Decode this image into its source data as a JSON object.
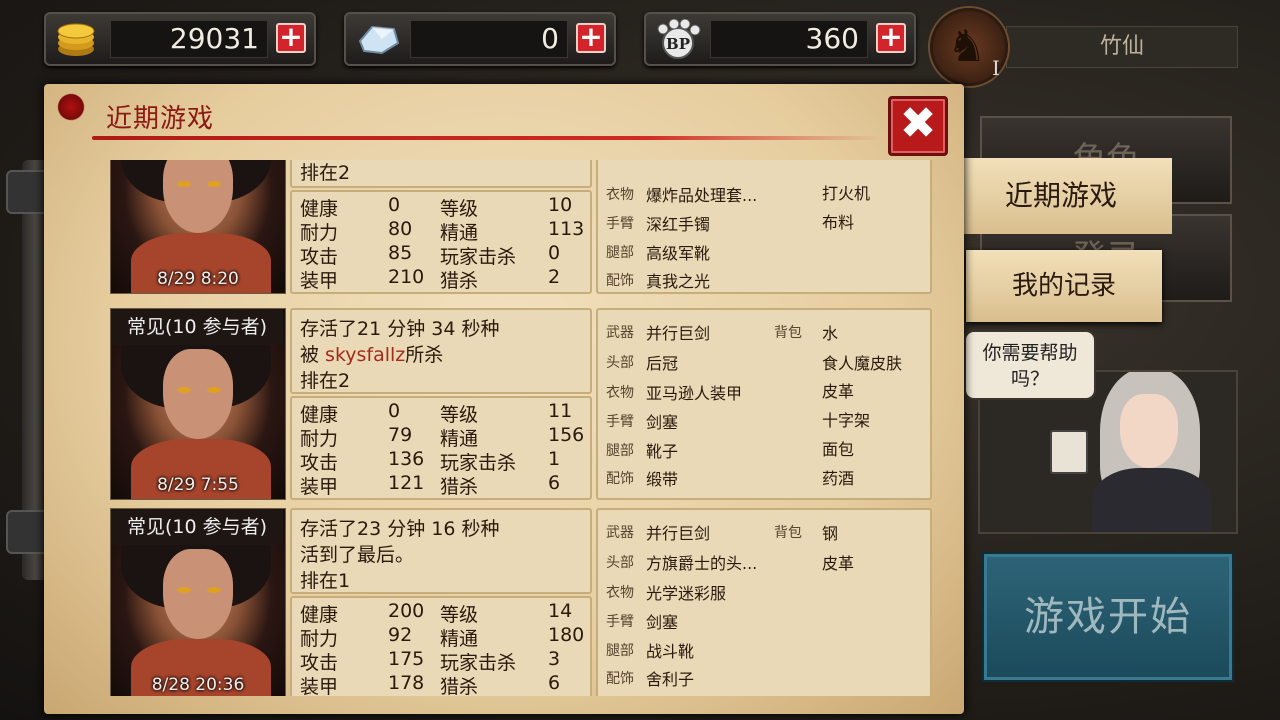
{
  "currency": {
    "gold": "29031",
    "diamond": "0",
    "bp": "360",
    "bp_label": "BP"
  },
  "profile": {
    "name": "竹仙",
    "level": "I"
  },
  "panel": {
    "title": "近期游戏"
  },
  "entries": [
    {
      "tag": "",
      "time": "8/29  8:20",
      "info": [
        "",
        "",
        "排在2"
      ],
      "stats": [
        [
          "健康",
          "0",
          "等级",
          "10"
        ],
        [
          "耐力",
          "80",
          "精通",
          "113"
        ],
        [
          "攻击",
          "85",
          "玩家击杀",
          "0"
        ],
        [
          "装甲",
          "210",
          "猎杀",
          "2"
        ]
      ],
      "equip": {
        "weapon": "",
        "bag_label": "",
        "bag": "",
        "head": "",
        "head_extra": "",
        "body": "爆炸品处理套...",
        "body_extra": "打火机",
        "arm": "深红手镯",
        "arm_extra": "布料",
        "leg": "高级军靴",
        "leg_extra": "",
        "acc": "真我之光",
        "acc_extra": ""
      }
    },
    {
      "tag": "常见(10 参与者)",
      "time": "8/29  7:55",
      "info": [
        "存活了21 分钟 34 秒种",
        "被 skysfallz所杀",
        "排在2"
      ],
      "killer": "skysfallz",
      "stats": [
        [
          "健康",
          "0",
          "等级",
          "11"
        ],
        [
          "耐力",
          "79",
          "精通",
          "156"
        ],
        [
          "攻击",
          "136",
          "玩家击杀",
          "1"
        ],
        [
          "装甲",
          "121",
          "猎杀",
          "6"
        ]
      ],
      "equip": {
        "weapon": "并行巨剑",
        "bag_label": "背包",
        "bag": "水",
        "head": "后冠",
        "head_extra": "食人魔皮肤",
        "body": "亚马逊人装甲",
        "body_extra": "皮革",
        "arm": "剑塞",
        "arm_extra": "十字架",
        "leg": "靴子",
        "leg_extra": "面包",
        "acc": "缎带",
        "acc_extra": "药酒"
      }
    },
    {
      "tag": "常见(10 参与者)",
      "time": "8/28  20:36",
      "info": [
        "存活了23 分钟 16 秒种",
        "活到了最后。",
        "排在1"
      ],
      "stats": [
        [
          "健康",
          "200",
          "等级",
          "14"
        ],
        [
          "耐力",
          "92",
          "精通",
          "180"
        ],
        [
          "攻击",
          "175",
          "玩家击杀",
          "3"
        ],
        [
          "装甲",
          "178",
          "猎杀",
          "6"
        ]
      ],
      "equip": {
        "weapon": "并行巨剑",
        "bag_label": "背包",
        "bag": "钢",
        "head": "方旗爵士的头...",
        "head_extra": "皮革",
        "body": "光学迷彩服",
        "body_extra": "",
        "arm": "剑塞",
        "arm_extra": "",
        "leg": "战斗靴",
        "leg_extra": "",
        "acc": "舍利子",
        "acc_extra": ""
      }
    }
  ],
  "slots": {
    "weapon": "武器",
    "head": "头部",
    "body": "衣物",
    "arm": "手臂",
    "leg": "腿部",
    "acc": "配饰"
  },
  "side": {
    "character": "角色",
    "recent": "近期游戏",
    "records_bg": "登录",
    "my_records": "我的记录"
  },
  "help": {
    "bubble": "你需要帮助吗？"
  },
  "start": {
    "label": "游戏开始"
  }
}
